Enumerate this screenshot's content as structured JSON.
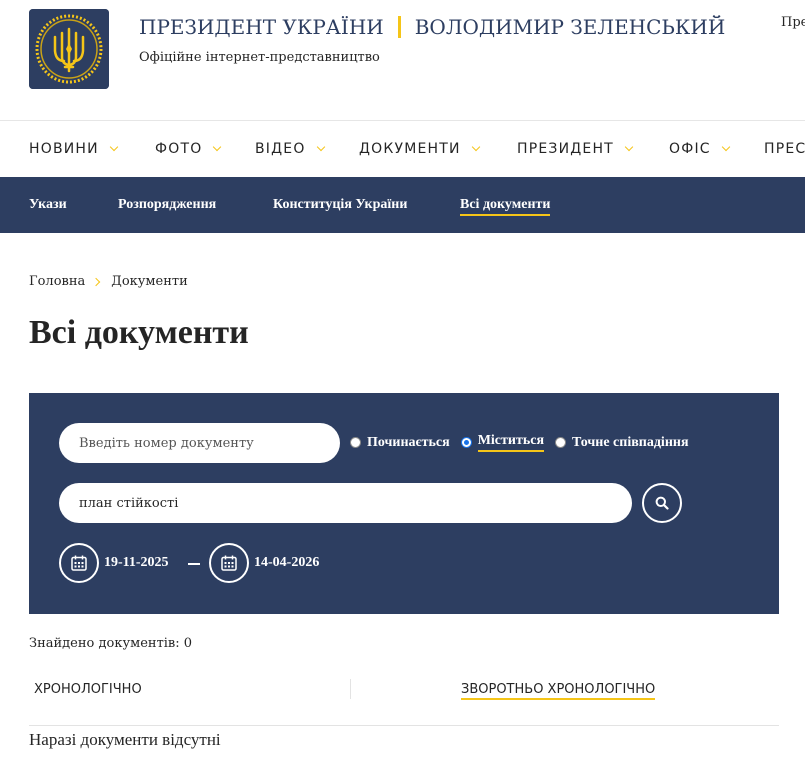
{
  "header": {
    "title_left": "ПРЕЗИДЕНТ УКРАЇНИ",
    "title_right": "ВОЛОДИМИР ЗЕЛЕНСЬКИЙ",
    "subtitle": "Офіційне інтернет-представництво",
    "corner_text": "Пре",
    "logo_icon": "trident-emblem-icon"
  },
  "mainnav": {
    "items": [
      {
        "label": "НОВИНИ"
      },
      {
        "label": "ФОТО"
      },
      {
        "label": "ВІДЕО"
      },
      {
        "label": "ДОКУМЕНТИ"
      },
      {
        "label": "ПРЕЗИДЕНТ"
      },
      {
        "label": "ОФІС"
      },
      {
        "label": "ПРЕС"
      }
    ]
  },
  "subnav": {
    "items": [
      {
        "label": "Укази"
      },
      {
        "label": "Розпорядження"
      },
      {
        "label": "Конституція України"
      },
      {
        "label": "Всі документи"
      }
    ],
    "active": "Всі документи"
  },
  "breadcrumb": {
    "home": "Головна",
    "current": "Документи"
  },
  "page_title": "Всі документи",
  "search": {
    "number_placeholder": "Введіть номер документу",
    "radios": [
      {
        "label": "Починається",
        "checked": false
      },
      {
        "label": "Міститься",
        "checked": true
      },
      {
        "label": "Точне співпадіння",
        "checked": false
      }
    ],
    "text_value": "план стійкості",
    "date_from": "19-11-2025",
    "date_to": "14-04-2026"
  },
  "results": {
    "found_text": "Знайдено документів: 0",
    "sort_chrono": "ХРОНОЛОГІЧНО",
    "sort_reverse": "ЗВОРОТНЬО ХРОНОЛОГІЧНО",
    "empty_text": "Наразі документи відсутні"
  },
  "colors": {
    "navy": "#2d3e61",
    "accent": "#f5c518"
  }
}
